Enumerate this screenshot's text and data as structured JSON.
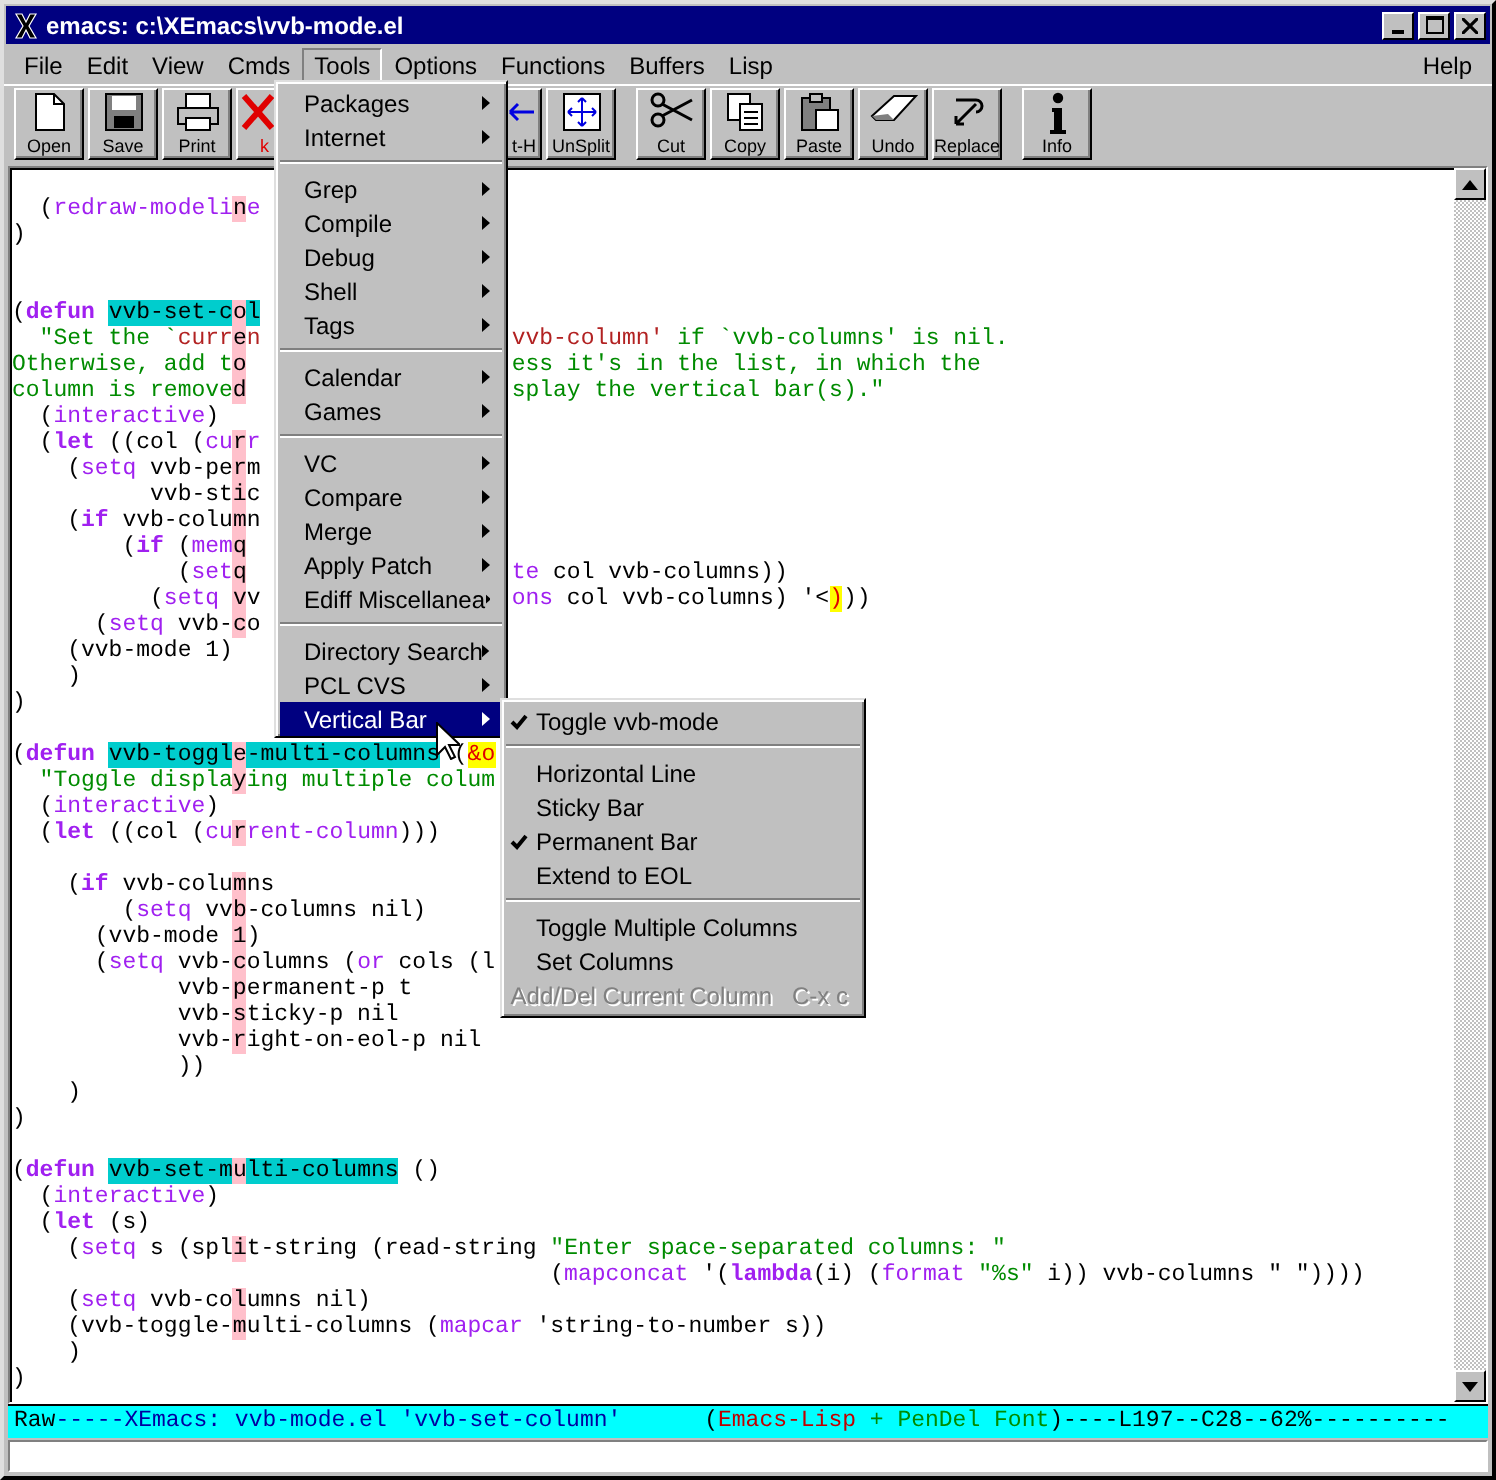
{
  "window": {
    "title": "emacs: c:\\XEmacs\\vvb-mode.el"
  },
  "menubar": [
    {
      "label": "File",
      "selected": false
    },
    {
      "label": "Edit",
      "selected": false
    },
    {
      "label": "View",
      "selected": false
    },
    {
      "label": "Cmds",
      "selected": false
    },
    {
      "label": "Tools",
      "selected": true
    },
    {
      "label": "Options",
      "selected": false
    },
    {
      "label": "Functions",
      "selected": false
    },
    {
      "label": "Buffers",
      "selected": false
    },
    {
      "label": "Lisp",
      "selected": false
    },
    {
      "label": "Help",
      "selected": false
    }
  ],
  "toolbar": [
    {
      "label": "Open"
    },
    {
      "label": "Save"
    },
    {
      "label": "Print"
    },
    {
      "label": "k"
    },
    {
      "label": "t-H"
    },
    {
      "label": "UnSplit"
    },
    {
      "label": "Cut"
    },
    {
      "label": "Copy"
    },
    {
      "label": "Paste"
    },
    {
      "label": "Undo"
    },
    {
      "label": "Replace"
    },
    {
      "label": "Info"
    }
  ],
  "code_lines": [
    {
      "kind": "blank"
    },
    {
      "kind": "code",
      "left": [
        {
          "kind": "p",
          "text": "  ("
        },
        {
          "kind": "fn",
          "text": "redraw-modeli"
        },
        {
          "kind": "bar",
          "text": "n"
        },
        {
          "kind": "fn",
          "text": "e"
        }
      ]
    },
    {
      "kind": "code",
      "left": [
        {
          "kind": "p",
          "text": ")"
        }
      ]
    },
    {
      "kind": "blank"
    },
    {
      "kind": "blank"
    },
    {
      "kind": "code",
      "left": [
        {
          "kind": "p",
          "text": "("
        },
        {
          "kind": "kw",
          "text": "defun "
        },
        {
          "kind": "name",
          "text": "vvb-set-c"
        },
        {
          "kind": "bar",
          "text": "o"
        },
        {
          "kind": "name",
          "text": "l"
        }
      ]
    },
    {
      "kind": "code",
      "left": [
        {
          "kind": "doc",
          "text": "  \"Set the `"
        },
        {
          "kind": "ref",
          "text": "curr"
        },
        {
          "kind": "bar",
          "text": "e"
        },
        {
          "kind": "ref",
          "text": "n"
        }
      ],
      "right": [
        {
          "kind": "ref",
          "text": "vvb-column'"
        },
        {
          "kind": "doc",
          "text": " if `vvb-columns' is nil."
        }
      ]
    },
    {
      "kind": "code",
      "left": [
        {
          "kind": "doc",
          "text": "Otherwise, add t"
        },
        {
          "kind": "bar",
          "text": "o"
        }
      ],
      "right": [
        {
          "kind": "doc",
          "text": "ess it's in the list, in which the"
        }
      ]
    },
    {
      "kind": "code",
      "left": [
        {
          "kind": "doc",
          "text": "column is remove"
        },
        {
          "kind": "bar",
          "text": "d"
        }
      ],
      "right": [
        {
          "kind": "doc",
          "text": "splay the vertical bar(s).\""
        }
      ]
    },
    {
      "kind": "code",
      "left": [
        {
          "kind": "p",
          "text": "  ("
        },
        {
          "kind": "fn",
          "text": "interactive"
        },
        {
          "kind": "p",
          "text": ")"
        }
      ]
    },
    {
      "kind": "code",
      "left": [
        {
          "kind": "p",
          "text": "  ("
        },
        {
          "kind": "kw",
          "text": "let"
        },
        {
          "kind": "p",
          "text": " ((col ("
        },
        {
          "kind": "fn",
          "text": "cu"
        },
        {
          "kind": "bar",
          "text": "r"
        },
        {
          "kind": "fn",
          "text": "r"
        }
      ]
    },
    {
      "kind": "code",
      "left": [
        {
          "kind": "p",
          "text": "    ("
        },
        {
          "kind": "fn",
          "text": "setq"
        },
        {
          "kind": "p",
          "text": " vvb-pe"
        },
        {
          "kind": "bar",
          "text": "r"
        },
        {
          "kind": "p",
          "text": "m"
        }
      ]
    },
    {
      "kind": "code",
      "left": [
        {
          "kind": "p",
          "text": "          vvb-st"
        },
        {
          "kind": "bar",
          "text": "i"
        },
        {
          "kind": "p",
          "text": "c"
        }
      ]
    },
    {
      "kind": "code",
      "left": [
        {
          "kind": "p",
          "text": "    ("
        },
        {
          "kind": "kw",
          "text": "if"
        },
        {
          "kind": "p",
          "text": " vvb-colu"
        },
        {
          "kind": "bar",
          "text": "m"
        },
        {
          "kind": "p",
          "text": "n"
        }
      ]
    },
    {
      "kind": "code",
      "left": [
        {
          "kind": "p",
          "text": "        ("
        },
        {
          "kind": "kw",
          "text": "if"
        },
        {
          "kind": "p",
          "text": " ("
        },
        {
          "kind": "fn",
          "text": "mem"
        },
        {
          "kind": "bar",
          "text": "q"
        }
      ]
    },
    {
      "kind": "code",
      "left": [
        {
          "kind": "p",
          "text": "            ("
        },
        {
          "kind": "fn",
          "text": "set"
        },
        {
          "kind": "bar",
          "text": "q"
        }
      ],
      "right": [
        {
          "kind": "fn",
          "text": "te"
        },
        {
          "kind": "p",
          "text": " col vvb-columns))"
        }
      ]
    },
    {
      "kind": "code",
      "left": [
        {
          "kind": "p",
          "text": "          ("
        },
        {
          "kind": "fn",
          "text": "setq "
        },
        {
          "kind": "bar",
          "text": "v"
        },
        {
          "kind": "p",
          "text": "v"
        }
      ],
      "right": [
        {
          "kind": "fn",
          "text": "ons"
        },
        {
          "kind": "p",
          "text": " col vvb-columns) '<"
        },
        {
          "kind": "hl",
          "text": ")"
        },
        {
          "kind": "p",
          "text": "))"
        }
      ]
    },
    {
      "kind": "code",
      "left": [
        {
          "kind": "p",
          "text": "      ("
        },
        {
          "kind": "fn",
          "text": "setq"
        },
        {
          "kind": "p",
          "text": " vvb-"
        },
        {
          "kind": "bar",
          "text": "c"
        },
        {
          "kind": "p",
          "text": "o"
        }
      ]
    },
    {
      "kind": "code",
      "left": [
        {
          "kind": "p",
          "text": "    (vvb-mode 1)"
        }
      ]
    },
    {
      "kind": "code",
      "left": [
        {
          "kind": "p",
          "text": "    )"
        }
      ]
    },
    {
      "kind": "code",
      "left": [
        {
          "kind": "p",
          "text": ")"
        }
      ]
    },
    {
      "kind": "blank"
    },
    {
      "kind": "code",
      "left": [
        {
          "kind": "p",
          "text": "("
        },
        {
          "kind": "kw",
          "text": "defun "
        },
        {
          "kind": "name",
          "text": "vvb-toggl"
        },
        {
          "kind": "bar",
          "text": "e"
        },
        {
          "kind": "name",
          "text": "-multi-columns"
        },
        {
          "kind": "p",
          "text": " ("
        },
        {
          "kind": "hl",
          "text": "&o"
        }
      ]
    },
    {
      "kind": "code",
      "left": [
        {
          "kind": "doc",
          "text": "  \"Toggle displa"
        },
        {
          "kind": "bar",
          "text": "y"
        },
        {
          "kind": "doc",
          "text": "ing multiple colum"
        }
      ]
    },
    {
      "kind": "code",
      "left": [
        {
          "kind": "p",
          "text": "  ("
        },
        {
          "kind": "fn",
          "text": "interactive"
        },
        {
          "kind": "p",
          "text": ")"
        }
      ]
    },
    {
      "kind": "code",
      "left": [
        {
          "kind": "p",
          "text": "  ("
        },
        {
          "kind": "kw",
          "text": "let"
        },
        {
          "kind": "p",
          "text": " ((col ("
        },
        {
          "kind": "fn",
          "text": "cu"
        },
        {
          "kind": "bar",
          "text": "r"
        },
        {
          "kind": "fn",
          "text": "rent-column"
        },
        {
          "kind": "p",
          "text": ")))"
        }
      ]
    },
    {
      "kind": "blank"
    },
    {
      "kind": "code",
      "left": [
        {
          "kind": "p",
          "text": "    ("
        },
        {
          "kind": "kw",
          "text": "if"
        },
        {
          "kind": "p",
          "text": " vvb-colu"
        },
        {
          "kind": "bar",
          "text": "m"
        },
        {
          "kind": "p",
          "text": "ns"
        }
      ]
    },
    {
      "kind": "code",
      "left": [
        {
          "kind": "p",
          "text": "        ("
        },
        {
          "kind": "fn",
          "text": "setq"
        },
        {
          "kind": "p",
          "text": " vv"
        },
        {
          "kind": "bar",
          "text": "b"
        },
        {
          "kind": "p",
          "text": "-columns nil)"
        }
      ]
    },
    {
      "kind": "code",
      "left": [
        {
          "kind": "p",
          "text": "      (vvb-mode "
        },
        {
          "kind": "bar",
          "text": "1"
        },
        {
          "kind": "p",
          "text": ")"
        }
      ]
    },
    {
      "kind": "code",
      "left": [
        {
          "kind": "p",
          "text": "      ("
        },
        {
          "kind": "fn",
          "text": "setq"
        },
        {
          "kind": "p",
          "text": " vvb-"
        },
        {
          "kind": "bar",
          "text": "c"
        },
        {
          "kind": "p",
          "text": "olumns ("
        },
        {
          "kind": "fn",
          "text": "or"
        },
        {
          "kind": "p",
          "text": " cols (l"
        }
      ]
    },
    {
      "kind": "code",
      "left": [
        {
          "kind": "p",
          "text": "            vvb-"
        },
        {
          "kind": "bar",
          "text": "p"
        },
        {
          "kind": "p",
          "text": "ermanent-p t"
        }
      ]
    },
    {
      "kind": "code",
      "left": [
        {
          "kind": "p",
          "text": "            vvb-"
        },
        {
          "kind": "bar",
          "text": "s"
        },
        {
          "kind": "p",
          "text": "ticky-p nil"
        }
      ]
    },
    {
      "kind": "code",
      "left": [
        {
          "kind": "p",
          "text": "            vvb-"
        },
        {
          "kind": "bar",
          "text": "r"
        },
        {
          "kind": "p",
          "text": "ight-on-eol-p nil"
        }
      ]
    },
    {
      "kind": "code",
      "left": [
        {
          "kind": "p",
          "text": "            ))"
        }
      ]
    },
    {
      "kind": "code",
      "left": [
        {
          "kind": "p",
          "text": "    )"
        }
      ]
    },
    {
      "kind": "code",
      "left": [
        {
          "kind": "p",
          "text": ")"
        }
      ]
    },
    {
      "kind": "blank"
    },
    {
      "kind": "code",
      "left": [
        {
          "kind": "p",
          "text": "("
        },
        {
          "kind": "kw",
          "text": "defun "
        },
        {
          "kind": "name",
          "text": "vvb-set-m"
        },
        {
          "kind": "bar",
          "text": "u"
        },
        {
          "kind": "name",
          "text": "lti-columns"
        },
        {
          "kind": "p",
          "text": " ()"
        }
      ]
    },
    {
      "kind": "code",
      "left": [
        {
          "kind": "p",
          "text": "  ("
        },
        {
          "kind": "fn",
          "text": "interactive"
        },
        {
          "kind": "p",
          "text": ")"
        }
      ]
    },
    {
      "kind": "code",
      "left": [
        {
          "kind": "p",
          "text": "  ("
        },
        {
          "kind": "kw",
          "text": "let"
        },
        {
          "kind": "p",
          "text": " (s)"
        }
      ]
    },
    {
      "kind": "code",
      "left": [
        {
          "kind": "p",
          "text": "    ("
        },
        {
          "kind": "fn",
          "text": "setq"
        },
        {
          "kind": "p",
          "text": " s (spl"
        },
        {
          "kind": "bar",
          "text": "i"
        },
        {
          "kind": "p",
          "text": "t-string (read-string "
        },
        {
          "kind": "doc",
          "text": "\"Enter space-separated columns: \""
        }
      ]
    },
    {
      "kind": "code",
      "left": [
        {
          "kind": "p",
          "text": "                                       ("
        },
        {
          "kind": "fn",
          "text": "mapconcat"
        },
        {
          "kind": "p",
          "text": " '("
        },
        {
          "kind": "kw",
          "text": "lambda"
        },
        {
          "kind": "p",
          "text": "(i) ("
        },
        {
          "kind": "fn",
          "text": "format "
        },
        {
          "kind": "doc",
          "text": "\"%s\""
        },
        {
          "kind": "p",
          "text": " i)) vvb-columns \" \"))))"
        }
      ]
    },
    {
      "kind": "code",
      "left": [
        {
          "kind": "p",
          "text": "    ("
        },
        {
          "kind": "fn",
          "text": "setq"
        },
        {
          "kind": "p",
          "text": " vvb-co"
        },
        {
          "kind": "bar",
          "text": "l"
        },
        {
          "kind": "p",
          "text": "umns nil)"
        }
      ]
    },
    {
      "kind": "code",
      "left": [
        {
          "kind": "p",
          "text": "    (vvb-toggle-"
        },
        {
          "kind": "bar",
          "text": "m"
        },
        {
          "kind": "p",
          "text": "ulti-columns ("
        },
        {
          "kind": "fn",
          "text": "mapcar"
        },
        {
          "kind": "p",
          "text": " 'string-to-number s))"
        }
      ]
    },
    {
      "kind": "code",
      "left": [
        {
          "kind": "p",
          "text": "    )"
        }
      ]
    },
    {
      "kind": "code",
      "left": [
        {
          "kind": "p",
          "text": ")"
        }
      ]
    }
  ],
  "mode_line": [
    {
      "kind": "p",
      "text": "Raw"
    },
    {
      "kind": "id",
      "text": "-----XEmacs: vvb-mode.el 'vvb-set-column'"
    },
    {
      "kind": "p",
      "text": "      ("
    },
    {
      "kind": "major",
      "text": "Emacs-Lisp"
    },
    {
      "kind": "minor",
      "text": " + PenDel Font"
    },
    {
      "kind": "p",
      "text": ")----L197--C28--62%----------"
    }
  ],
  "tools_menu": {
    "groups": [
      [
        {
          "label": "Packages",
          "selected": false
        },
        {
          "label": "Internet",
          "selected": false
        }
      ],
      [
        {
          "label": "Grep",
          "selected": false
        },
        {
          "label": "Compile",
          "selected": false
        },
        {
          "label": "Debug",
          "selected": false
        },
        {
          "label": "Shell",
          "selected": false
        },
        {
          "label": "Tags",
          "selected": false
        }
      ],
      [
        {
          "label": "Calendar",
          "selected": false
        },
        {
          "label": "Games",
          "selected": false
        }
      ],
      [
        {
          "label": "VC",
          "selected": false
        },
        {
          "label": "Compare",
          "selected": false
        },
        {
          "label": "Merge",
          "selected": false
        },
        {
          "label": "Apply Patch",
          "selected": false
        },
        {
          "label": "Ediff Miscellanea",
          "selected": false
        }
      ],
      [
        {
          "label": "Directory Search",
          "selected": false
        },
        {
          "label": "PCL CVS",
          "selected": false
        },
        {
          "label": "Vertical Bar",
          "selected": true
        }
      ]
    ]
  },
  "vertical_bar_menu": {
    "groups": [
      [
        {
          "label": "Toggle vvb-mode",
          "checked": true,
          "disabled": false
        }
      ],
      [
        {
          "label": "Horizontal Line",
          "checked": false,
          "disabled": false
        },
        {
          "label": "Sticky Bar",
          "checked": false,
          "disabled": false
        },
        {
          "label": "Permanent Bar",
          "checked": true,
          "disabled": false
        },
        {
          "label": "Extend to EOL",
          "checked": false,
          "disabled": false
        }
      ],
      [
        {
          "label": "Toggle Multiple Columns",
          "checked": false,
          "disabled": false
        },
        {
          "label": "Set Columns",
          "checked": false,
          "disabled": false
        },
        {
          "label": "Add/Del Current Column",
          "checked": false,
          "disabled": true,
          "shortcut": "C-x c"
        }
      ]
    ]
  }
}
